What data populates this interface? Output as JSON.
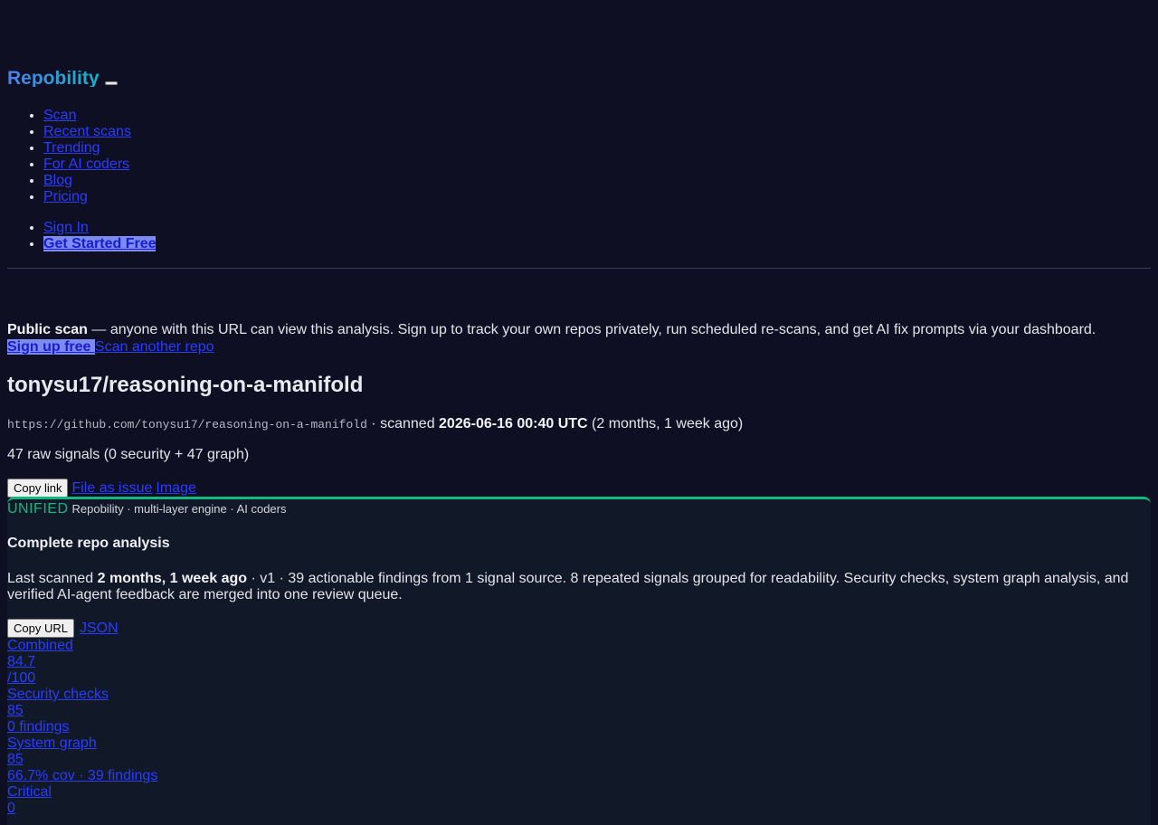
{
  "header": {
    "brand": "Repobility",
    "nav": [
      "Scan",
      "Recent scans",
      "Trending",
      "For AI coders",
      "Blog",
      "Pricing"
    ],
    "auth": {
      "sign_in": "Sign In",
      "get_started": "Get Started Free"
    }
  },
  "notice": {
    "bold": "Public scan",
    "text": " — anyone with this URL can view this analysis. Sign up to track your own repos privately, run scheduled re-scans, and get AI fix prompts via your dashboard.",
    "signup": "Sign up free ",
    "scan_another": "Scan another repo"
  },
  "repo": {
    "title": "tonysu17/reasoning-on-a-manifold",
    "url": "https://github.com/tonysu17/reasoning-on-a-manifold",
    "scanned_prefix": " · scanned ",
    "scanned_at": "2026-06-16 00:40 UTC",
    "scanned_ago": " (2 months, 1 week ago)",
    "signals": "47 raw signals (0 security + 47 graph)"
  },
  "actions": {
    "copy_link": "Copy link",
    "file_issue": "File as issue",
    "image": "Image"
  },
  "card": {
    "badge": "UNIFIED",
    "engine": "Repobility · multi-layer engine · AI coders",
    "title": "Complete repo analysis",
    "summary_prefix": "Last scanned ",
    "summary_bold": "2 months, 1 week ago",
    "summary_rest": " · v1 · 39 actionable findings from 1 signal source. 8 repeated signals grouped for readability. Security checks, system graph analysis, and verified AI-agent feedback are merged into one review queue.",
    "copy_url": "Copy URL",
    "json": "JSON",
    "scores": {
      "combined_label": "Combined",
      "combined_value": "84.7",
      "combined_scale": "/100",
      "security_label": "Security checks",
      "security_value": "85",
      "security_findings": "0 findings",
      "graph_label": "System graph",
      "graph_value": "85",
      "graph_detail": "66.7% cov · 39 findings",
      "critical_label": "Critical",
      "critical_value": "0"
    }
  },
  "colors": {
    "background": "#0f0f23",
    "link": "#2a3cff",
    "accent_green": "#10b981",
    "cta_bg": "#7b8bf0"
  }
}
